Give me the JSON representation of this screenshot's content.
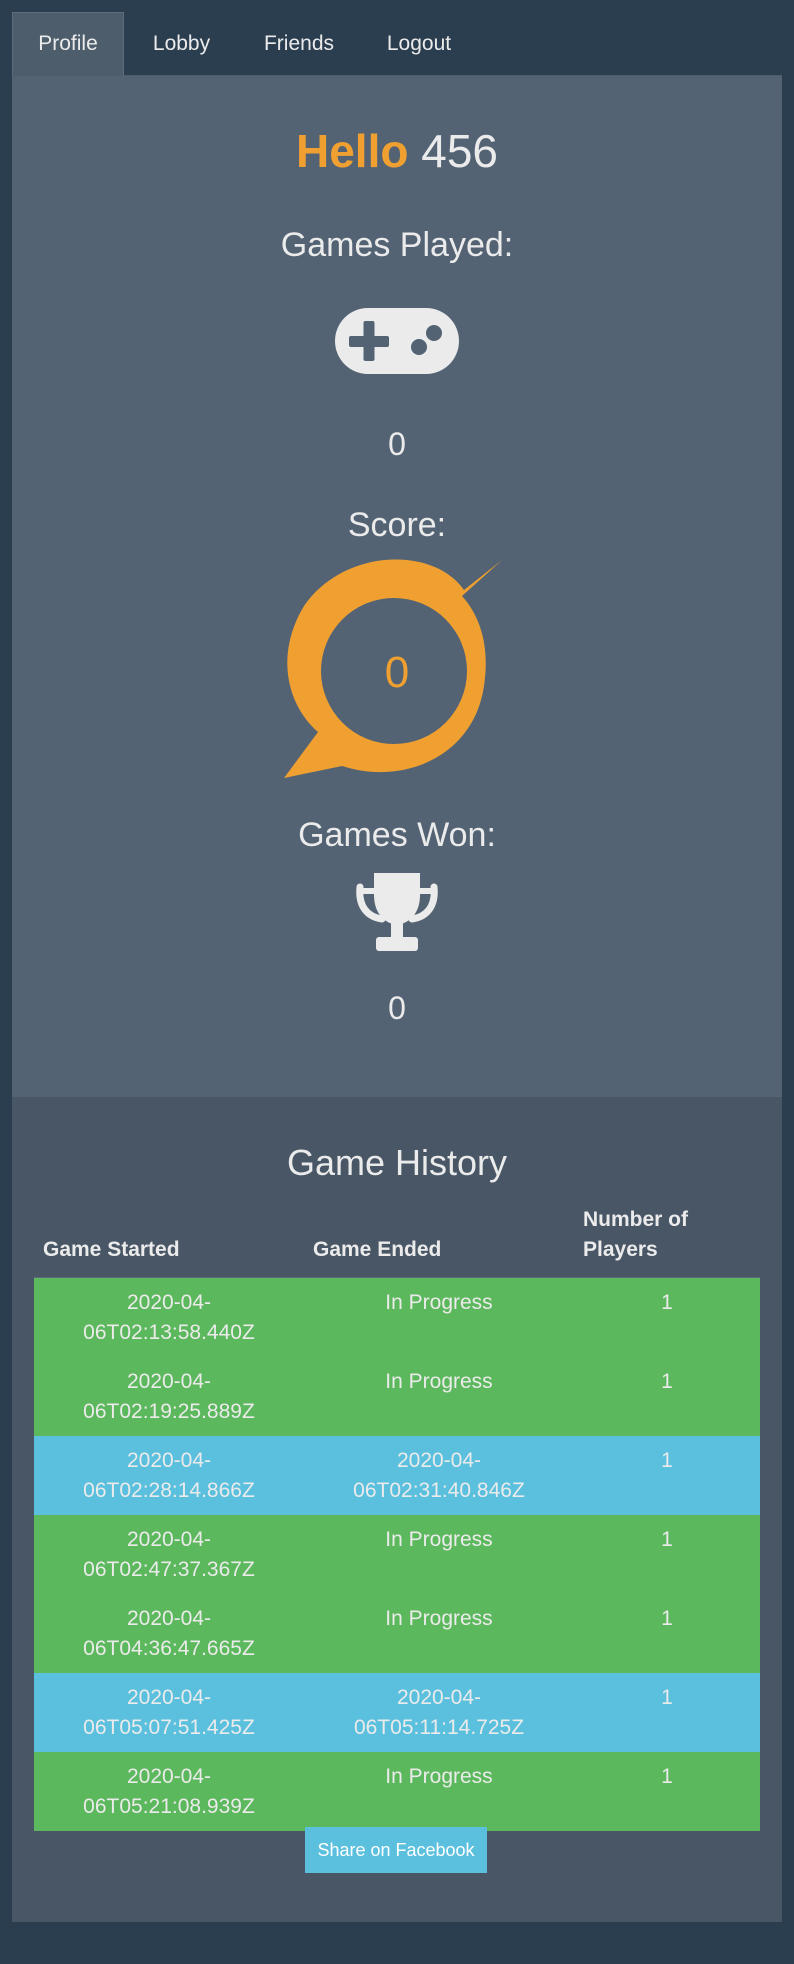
{
  "nav": {
    "tabs": [
      {
        "label": "Profile",
        "active": true
      },
      {
        "label": "Lobby",
        "active": false
      },
      {
        "label": "Friends",
        "active": false
      },
      {
        "label": "Logout",
        "active": false
      }
    ]
  },
  "profile": {
    "greeting": "Hello",
    "username": "456",
    "games_played_label": "Games Played:",
    "games_played": "0",
    "score_label": "Score:",
    "score": "0",
    "games_won_label": "Games Won:",
    "games_won": "0",
    "icons": {
      "games_played": "gamepad-icon",
      "score": "score-ring-icon",
      "games_won": "trophy-icon"
    }
  },
  "history": {
    "title": "Game History",
    "columns": [
      "Game Started",
      "Game Ended",
      "Number of Players"
    ],
    "rows": [
      {
        "started": "2020-04-06T02:13:58.440Z",
        "ended": "In Progress",
        "players": "1",
        "status": "in-progress"
      },
      {
        "started": "2020-04-06T02:19:25.889Z",
        "ended": "In Progress",
        "players": "1",
        "status": "in-progress"
      },
      {
        "started": "2020-04-06T02:28:14.866Z",
        "ended": "2020-04-06T02:31:40.846Z",
        "players": "1",
        "status": "ended"
      },
      {
        "started": "2020-04-06T02:47:37.367Z",
        "ended": "In Progress",
        "players": "1",
        "status": "in-progress"
      },
      {
        "started": "2020-04-06T04:36:47.665Z",
        "ended": "In Progress",
        "players": "1",
        "status": "in-progress"
      },
      {
        "started": "2020-04-06T05:07:51.425Z",
        "ended": "2020-04-06T05:11:14.725Z",
        "players": "1",
        "status": "ended"
      },
      {
        "started": "2020-04-06T05:21:08.939Z",
        "ended": "In Progress",
        "players": "1",
        "status": "in-progress"
      }
    ],
    "share_label": "Share on Facebook"
  },
  "colors": {
    "background": "#2b3e50",
    "panel": "#536374",
    "history_panel": "#485666",
    "accent": "#f0a030",
    "in_progress_row": "#5cb85c",
    "ended_row": "#5bc0de",
    "share_button": "#5bc0de"
  }
}
